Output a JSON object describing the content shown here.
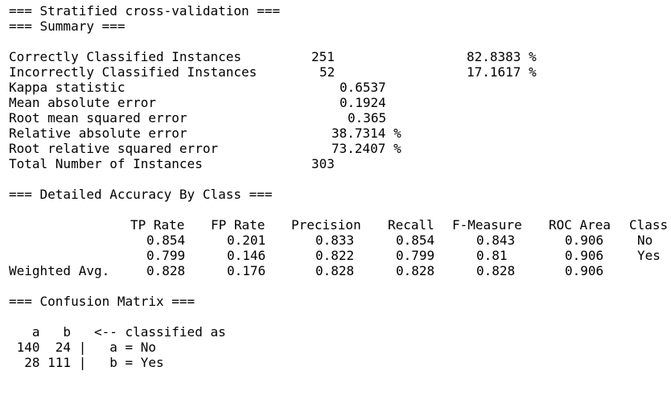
{
  "headers": {
    "stratified": "=== Stratified cross-validation ===",
    "summary": "=== Summary ===",
    "detailed": "=== Detailed Accuracy By Class ===",
    "confusion": "=== Confusion Matrix ==="
  },
  "summary_rows": [
    {
      "label": "Correctly Classified Instances",
      "value": "251",
      "percent": "82.8383 %"
    },
    {
      "label": "Incorrectly Classified Instances",
      "value": "52",
      "percent": "17.1617 %"
    },
    {
      "label": "Kappa statistic",
      "value": "0.6537",
      "percent": ""
    },
    {
      "label": "Mean absolute error",
      "value": "0.1924",
      "percent": ""
    },
    {
      "label": "Root mean squared error",
      "value": "0.365",
      "percent": ""
    },
    {
      "label": "Relative absolute error",
      "value": "38.7314 %",
      "percent": ""
    },
    {
      "label": "Root relative squared error",
      "value": "73.2407 %",
      "percent": ""
    },
    {
      "label": "Total Number of Instances",
      "value": "303",
      "percent": ""
    }
  ],
  "accuracy": {
    "columns": [
      "TP Rate",
      "FP Rate",
      "Precision",
      "Recall",
      "F-Measure",
      "ROC Area",
      "Class"
    ],
    "rows": [
      {
        "label": "",
        "cells": [
          "0.854",
          "0.201",
          "0.833",
          "0.854",
          "0.843",
          "0.906",
          "No"
        ]
      },
      {
        "label": "",
        "cells": [
          "0.799",
          "0.146",
          "0.822",
          "0.799",
          "0.81",
          "0.906",
          "Yes"
        ]
      },
      {
        "label": "Weighted Avg.",
        "cells": [
          "0.828",
          "0.176",
          "0.828",
          "0.828",
          "0.828",
          "0.906",
          ""
        ]
      }
    ]
  },
  "confusion": {
    "header": "   a   b   <-- classified as",
    "rows": [
      " 140  24 |   a = No",
      "  28 111 |   b = Yes"
    ]
  }
}
